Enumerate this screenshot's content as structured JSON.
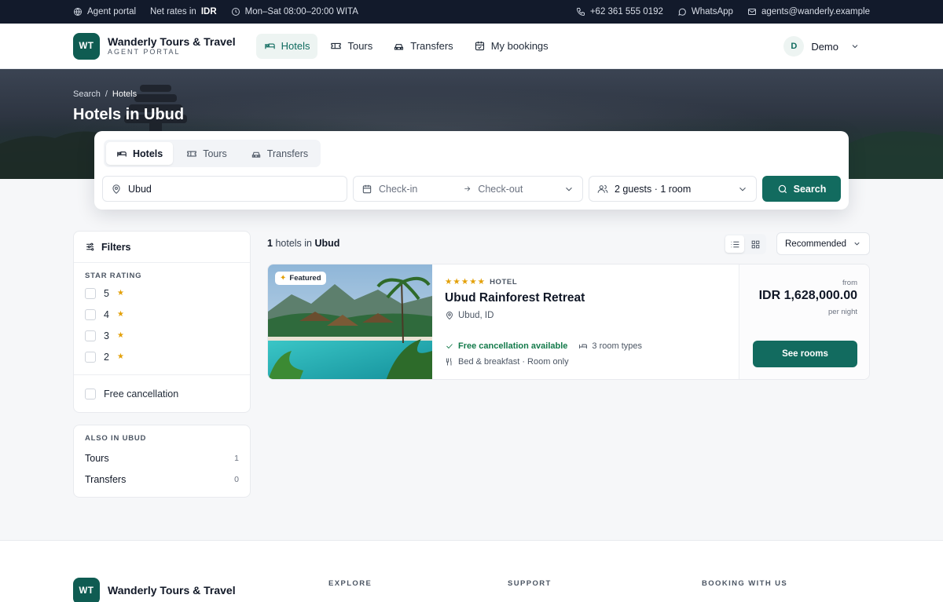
{
  "topbar": {
    "portal": "Agent portal",
    "rates_prefix": "Net rates in",
    "currency": "IDR",
    "hours": "Mon–Sat 08:00–20:00 WITA",
    "phone": "+62 361 555 0192",
    "whatsapp": "WhatsApp",
    "email": "agents@wanderly.example"
  },
  "header": {
    "logo": "WT",
    "brand": "Wanderly Tours & Travel",
    "subtitle": "AGENT PORTAL",
    "nav": [
      "Hotels",
      "Tours",
      "Transfers",
      "My bookings"
    ],
    "user_initial": "D",
    "user_name": "Demo"
  },
  "hero": {
    "crumb_search": "Search",
    "crumb_sep": "/",
    "crumb_current": "Hotels",
    "title": "Hotels in Ubud"
  },
  "search": {
    "tabs": [
      "Hotels",
      "Tours",
      "Transfers"
    ],
    "destination": "Ubud",
    "checkin": "Check-in",
    "checkout": "Check-out",
    "guests": "2 guests · 1 room",
    "button": "Search"
  },
  "filters": {
    "title": "Filters",
    "star_section": "STAR RATING",
    "stars": [
      "5",
      "4",
      "3",
      "2"
    ],
    "free_cancel": "Free cancellation"
  },
  "also": {
    "title": "ALSO IN UBUD",
    "items": [
      {
        "label": "Tours",
        "count": "1"
      },
      {
        "label": "Transfers",
        "count": "0"
      }
    ]
  },
  "results": {
    "count": "1",
    "count_text": "hotels in",
    "location": "Ubud",
    "sort": "Recommended"
  },
  "hotel": {
    "badge": "Featured",
    "stars": "★★★★★",
    "type": "HOTEL",
    "name": "Ubud Rainforest Retreat",
    "location": "Ubud, ID",
    "free_cancel": "Free cancellation available",
    "room_types": "3 room types",
    "board": "Bed & breakfast · Room only",
    "from": "from",
    "price": "IDR 1,628,000.00",
    "per_night": "per night",
    "button": "See rooms"
  },
  "footer": {
    "logo": "WT",
    "brand": "Wanderly Tours & Travel",
    "columns": [
      "EXPLORE",
      "SUPPORT",
      "BOOKING WITH US"
    ]
  },
  "colors": {
    "primary": "#126b5f",
    "topbar": "#121a2b",
    "star": "#e3a008",
    "success": "#137a4a"
  }
}
